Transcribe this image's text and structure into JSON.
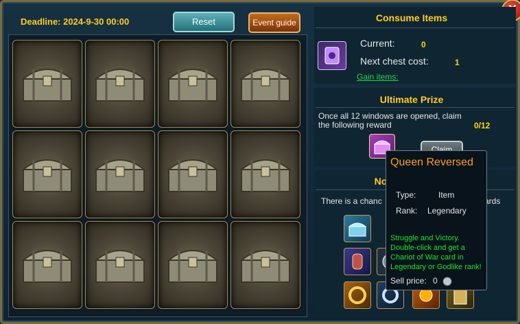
{
  "deadline": "Deadline: 2024-9-30 00:00",
  "buttons": {
    "reset": "Reset",
    "guide": "Event guide"
  },
  "consume": {
    "title": "Consume Items",
    "current_label": "Current:",
    "current_value": "0",
    "next_label": "Next chest cost:",
    "next_value": "1",
    "gain_link": "Gain items:"
  },
  "prize": {
    "title": "Ultimate Prize",
    "desc": "Once all 12 windows are opened, claim the following reward",
    "progress": "0/12",
    "claim": "Claim"
  },
  "notice": {
    "title": "No",
    "text_left": "There is a chanc",
    "text_right": "ards"
  },
  "tooltip": {
    "title": "Queen Reversed",
    "type_label": "Type:",
    "type_value": "Item",
    "rank_label": "Rank:",
    "rank_value": "Legendary",
    "desc": "Struggle and Victory. Double-click and get a Chariot of War card in Legendary or Godlike rank!",
    "sell_label": "Sell price:",
    "sell_value": "0"
  },
  "close": "✕"
}
